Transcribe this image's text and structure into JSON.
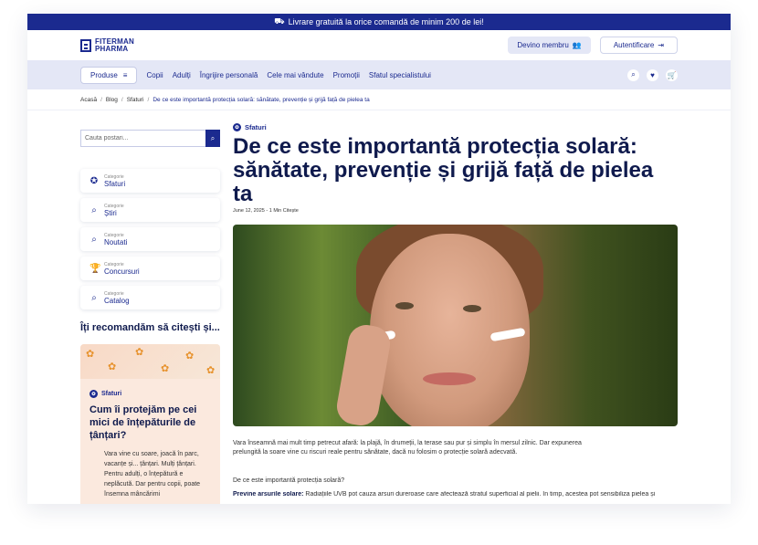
{
  "announcement": {
    "icon": "truck-icon",
    "text": "Livrare gratuită la orice comandă de minim 200 de lei!"
  },
  "header": {
    "logo_line1": "FITERMAN",
    "logo_line2": "PHARMA",
    "member_button": "Devino membru",
    "auth_button": "Autentificare"
  },
  "nav": {
    "products_button": "Produse",
    "items": [
      "Copii",
      "Adulți",
      "Îngrijire personală",
      "Cele mai vândute",
      "Promoții",
      "Sfatul specialistului"
    ]
  },
  "breadcrumb": {
    "items": [
      "Acasă",
      "Blog",
      "Sfaturi"
    ],
    "current": "De ce este importantă protecția solară: sănătate, prevenție și grijă față de pielea ta"
  },
  "sidebar": {
    "search_placeholder": "Cauta postari...",
    "category_label": "Categorie",
    "categories": [
      {
        "name": "Sfaturi",
        "icon": "badge-icon"
      },
      {
        "name": "Știri",
        "icon": "search-icon"
      },
      {
        "name": "Noutati",
        "icon": "search-icon"
      },
      {
        "name": "Concursuri",
        "icon": "trophy-icon"
      },
      {
        "name": "Catalog",
        "icon": "search-icon"
      }
    ],
    "recommend_heading": "Îți recomandăm să citești și...",
    "recommended": {
      "tag": "Sfaturi",
      "title": "Cum îi protejăm pe cei mici de înțepăturile de țânțari?",
      "text1": "Vara vine cu soare, joacă în parc, vacanțe și... țânțari. Mulți țânțari.",
      "text2": "Pentru adulți, o înțepătură e neplăcută. Dar pentru copii, poate însemna mâncărimi"
    }
  },
  "article": {
    "tag": "Sfaturi",
    "title": "De ce este importantă protecția solară: sănătate, prevenție și grijă față de pielea ta",
    "date": "June 12, 2025 - 1 Min Citește",
    "intro": "Vara înseamnă mai mult timp petrecut afară: la plajă, în drumeții, la terase sau pur și simplu în mersul zilnic. Dar expunerea prelungită la soare vine cu riscuri reale pentru sănătate, dacă nu folosim o protecție solară adecvată.",
    "question": "De ce este importantă protecția solară?",
    "point_label": "Previne arsurile solare:",
    "point_text": " Radiațiile UVB pot cauza arsuri dureroase care afectează stratul superficial al pielii. În timp, acestea pot sensibiliza pielea și"
  },
  "colors": {
    "brand": "#1b2a8f",
    "nav_bg": "#e4e7f6",
    "heading": "#0f1a4d"
  }
}
